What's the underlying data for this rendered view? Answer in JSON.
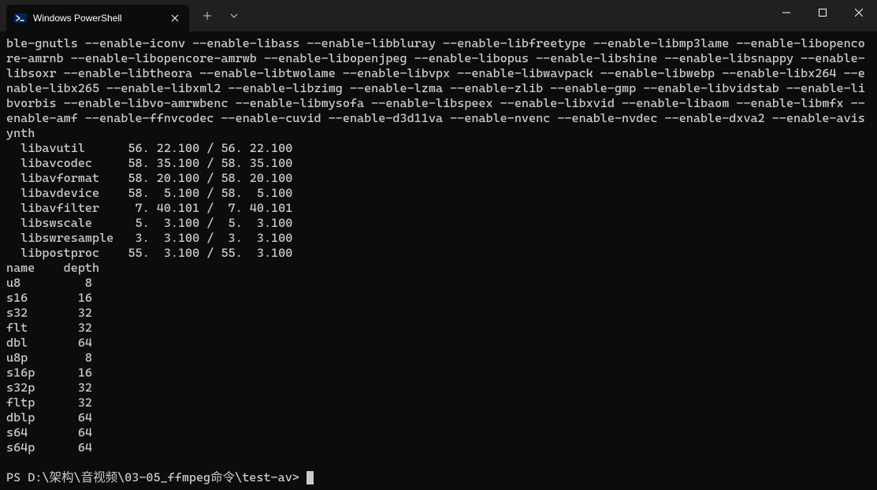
{
  "titlebar": {
    "tab": {
      "title": "Windows PowerShell",
      "icon_name": "powershell-icon"
    }
  },
  "terminal": {
    "config_line": "ble-gnutls --enable-iconv --enable-libass --enable-libbluray --enable-libfreetype --enable-libmp3lame --enable-libopencore-amrnb --enable-libopencore-amrwb --enable-libopenjpeg --enable-libopus --enable-libshine --enable-libsnappy --enable-libsoxr --enable-libtheora --enable-libtwolame --enable-libvpx --enable-libwavpack --enable-libwebp --enable-libx264 --enable-libx265 --enable-libxml2 --enable-libzimg --enable-lzma --enable-zlib --enable-gmp --enable-libvidstab --enable-libvorbis --enable-libvo-amrwbenc --enable-libmysofa --enable-libspeex --enable-libxvid --enable-libaom --enable-libmfx --enable-amf --enable-ffnvcodec --enable-cuvid --enable-d3d11va --enable-nvenc --enable-nvdec --enable-dxva2 --enable-avisynth",
    "libs": [
      "  libavutil      56. 22.100 / 56. 22.100",
      "  libavcodec     58. 35.100 / 58. 35.100",
      "  libavformat    58. 20.100 / 58. 20.100",
      "  libavdevice    58.  5.100 / 58.  5.100",
      "  libavfilter     7. 40.101 /  7. 40.101",
      "  libswscale      5.  3.100 /  5.  3.100",
      "  libswresample   3.  3.100 /  3.  3.100",
      "  libpostproc    55.  3.100 / 55.  3.100"
    ],
    "table_header": "name    depth",
    "formats": [
      "u8         8",
      "s16       16",
      "s32       32",
      "flt       32",
      "dbl       64",
      "u8p        8",
      "s16p      16",
      "s32p      32",
      "fltp      32",
      "dblp      64",
      "s64       64",
      "s64p      64"
    ],
    "blank": "",
    "prompt": "PS D:\\架构\\音视频\\03-05_ffmpeg命令\\test-av> "
  }
}
